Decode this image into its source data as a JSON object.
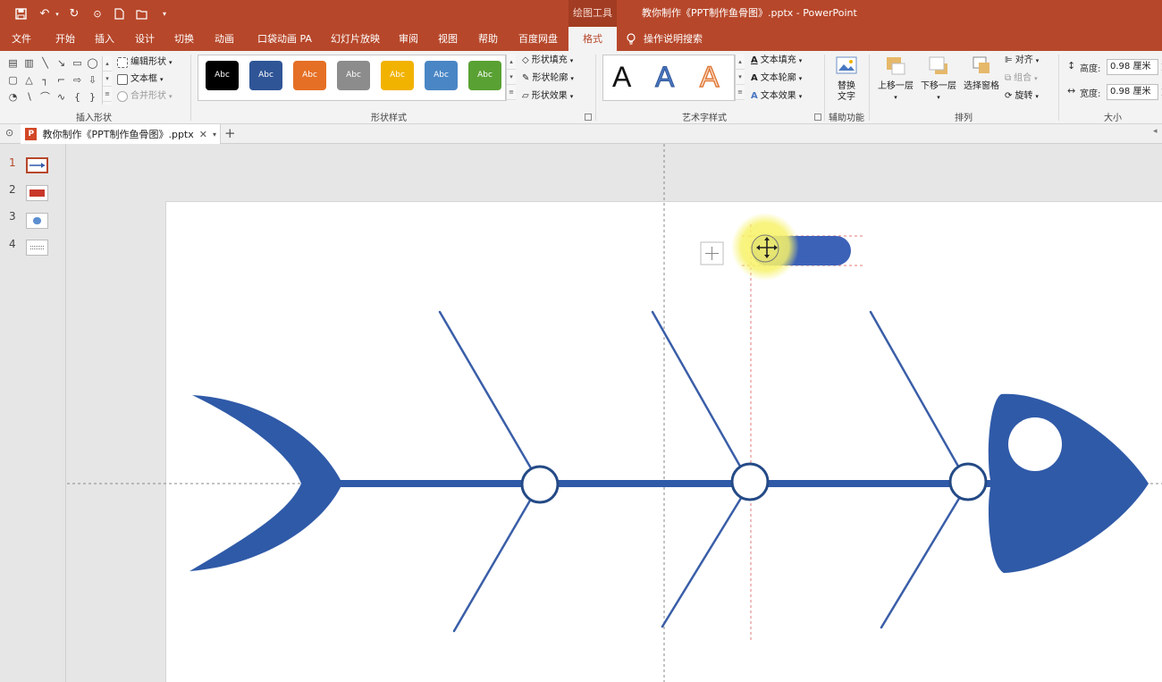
{
  "window": {
    "contextual_tab_group": "绘图工具",
    "title": "教你制作《PPT制作鱼骨图》.pptx  -  PowerPoint"
  },
  "tabs": [
    "文件",
    "开始",
    "插入",
    "设计",
    "切换",
    "动画",
    "口袋动画 PA",
    "幻灯片放映",
    "审阅",
    "视图",
    "帮助",
    "百度网盘",
    "格式"
  ],
  "active_tab": "格式",
  "tell_me": "操作说明搜索",
  "ribbon": {
    "insert_shapes": {
      "label": "插入形状",
      "edit_shape": "编辑形状",
      "text_box": "文本框",
      "merge_shapes": "合并形状"
    },
    "shape_styles": {
      "label": "形状样式",
      "swatch_text": "Abc",
      "swatches": [
        "#000000",
        "#2f5597",
        "#e56f24",
        "#8c8c8c",
        "#f2b200",
        "#4a86c5",
        "#5aa133"
      ],
      "fill": "形状填充",
      "outline": "形状轮廓",
      "effects": "形状效果"
    },
    "wordart_styles": {
      "label": "艺术字样式",
      "letter": "A",
      "text_fill": "文本填充",
      "text_outline": "文本轮廓",
      "text_effects": "文本效果"
    },
    "accessibility": {
      "label": "辅助功能",
      "alt_text_line1": "替换",
      "alt_text_line2": "文字"
    },
    "arrange": {
      "label": "排列",
      "bring_forward": "上移一层",
      "send_backward": "下移一层",
      "selection_pane": "选择窗格",
      "align": "对齐",
      "group": "组合",
      "rotate": "旋转"
    },
    "size": {
      "label": "大小",
      "height_label": "高度:",
      "height_value": "0.98 厘米",
      "width_label": "宽度:",
      "width_value": "0.98 厘米"
    }
  },
  "document_tab": "教你制作《PPT制作鱼骨图》.pptx",
  "slides": [
    "1",
    "2",
    "3",
    "4"
  ],
  "active_slide": "1",
  "colors": {
    "accent": "#b7472a",
    "fish_blue": "#2f5aa8",
    "bone_line": "#3a5ea8",
    "node_ring": "#244a86",
    "highlight": "#f7f26a"
  }
}
